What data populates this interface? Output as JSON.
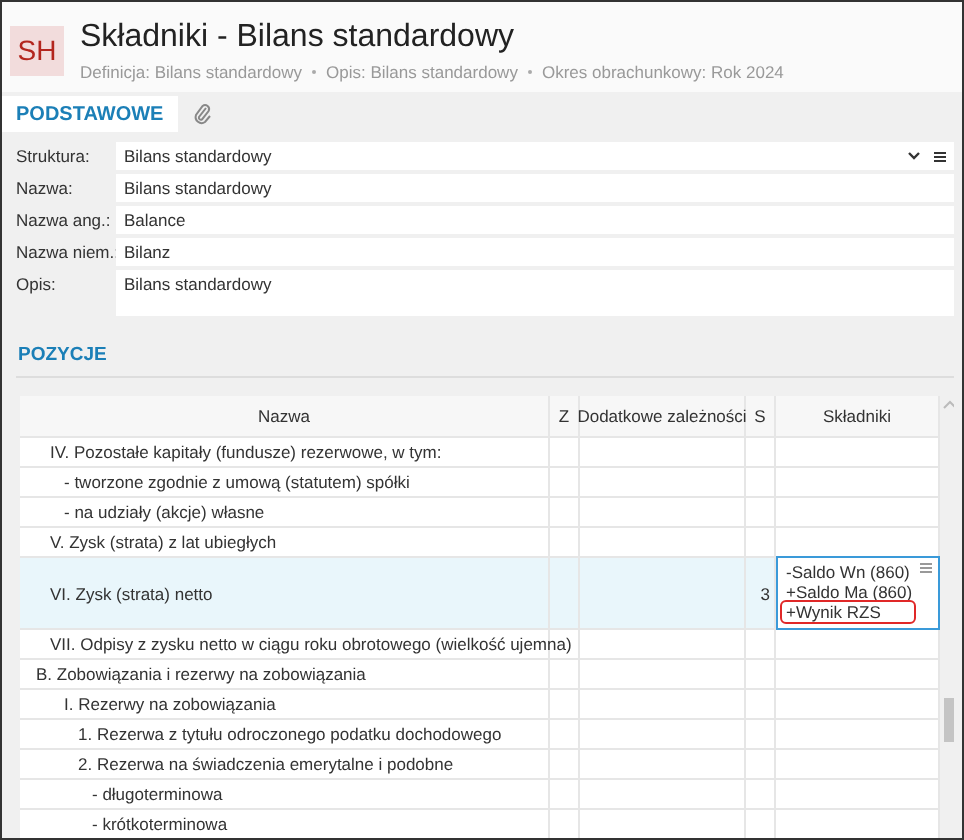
{
  "header": {
    "avatar": "SH",
    "title": "Składniki - Bilans standardowy",
    "meta": [
      "Definicja: Bilans standardowy",
      "Opis: Bilans standardowy",
      "Okres obrachunkowy: Rok 2024"
    ]
  },
  "tabs": [
    {
      "kind": "label",
      "label": "PODSTAWOWE",
      "selected": true
    },
    {
      "kind": "attachment",
      "selected": false
    }
  ],
  "fields": [
    {
      "kind": "dropdown",
      "label": "Struktura:",
      "value": "Bilans standardowy"
    },
    {
      "kind": "text",
      "label": "Nazwa:",
      "value": "Bilans standardowy"
    },
    {
      "kind": "text",
      "label": "Nazwa ang.:",
      "value": "Balance"
    },
    {
      "kind": "text",
      "label": "Nazwa niem.:",
      "value": "Bilanz"
    },
    {
      "kind": "multiline",
      "label": "Opis:",
      "value": "Bilans standardowy"
    }
  ],
  "section": "POZYCJE",
  "table": {
    "columns": [
      "Nazwa",
      "Z",
      "Dodatkowe zależności",
      "S",
      "Składniki"
    ],
    "rows": [
      {
        "kind": "item",
        "name": "IV. Pozostałe kapitały (fundusze) rezerwowe, w tym:",
        "selected": false,
        "children": [
          {
            "kind": "item",
            "name": "- tworzone zgodnie z umową (statutem) spółki",
            "selected": false
          },
          {
            "kind": "item",
            "name": "- na udziały (akcje) własne",
            "selected": false
          }
        ]
      },
      {
        "kind": "item",
        "name": "V. Zysk (strata) z lat ubiegłych",
        "selected": false
      },
      {
        "kind": "item",
        "name": "VI. Zysk (strata) netto",
        "selected": true,
        "s": "3",
        "components": [
          {
            "text": "-Saldo Wn (860)",
            "highlighted": false
          },
          {
            "text": "+Saldo Ma (860)",
            "highlighted": false
          },
          {
            "text": "+Wynik RZS",
            "highlighted": true
          }
        ]
      },
      {
        "kind": "item",
        "name": "VII. Odpisy z zysku netto w ciągu roku obrotowego (wielkość ujemna)",
        "selected": false
      },
      {
        "kind": "group",
        "name": "B. Zobowiązania i rezerwy na zobowiązania",
        "selected": false,
        "children": [
          {
            "kind": "item",
            "name": "I. Rezerwy na zobowiązania",
            "selected": false,
            "children": [
              {
                "kind": "item",
                "name": "1. Rezerwa z tytułu odroczonego podatku dochodowego",
                "selected": false
              },
              {
                "kind": "item",
                "name": "2. Rezerwa na świadczenia emerytalne i podobne",
                "selected": false,
                "children": [
                  {
                    "kind": "item",
                    "name": "- długoterminowa",
                    "selected": false
                  },
                  {
                    "kind": "item",
                    "name": "- krótkoterminowa",
                    "selected": false
                  }
                ]
              }
            ]
          }
        ]
      }
    ]
  }
}
